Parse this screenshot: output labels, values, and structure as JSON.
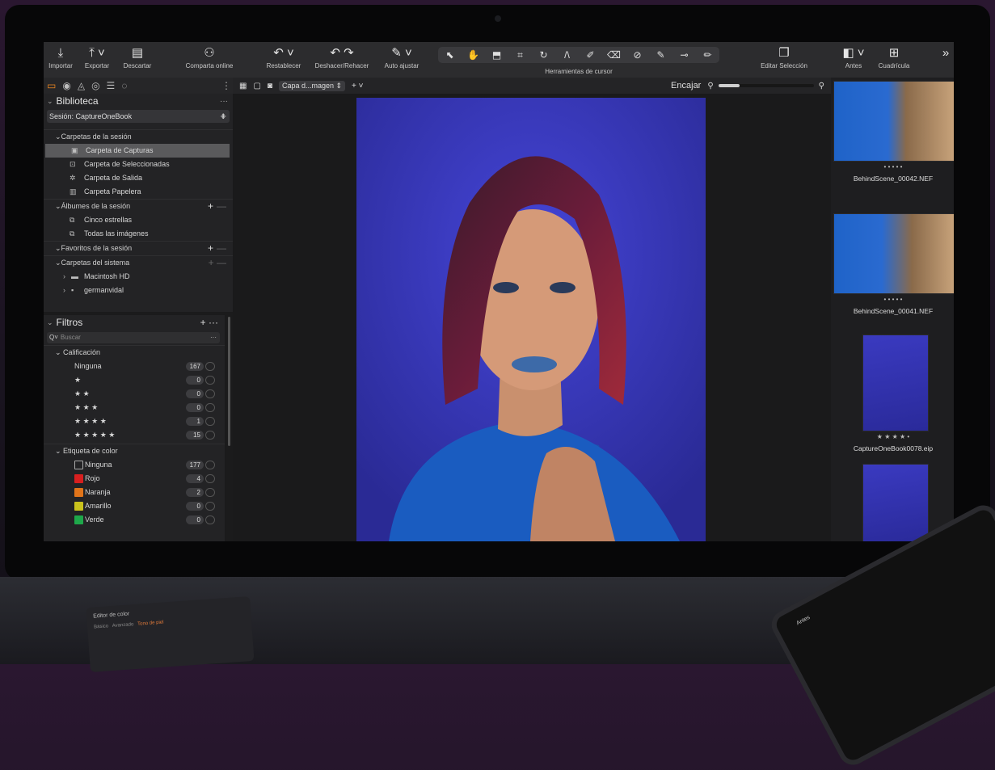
{
  "toolbar": {
    "left": [
      {
        "icon": "import-icon",
        "label": "Importar"
      },
      {
        "icon": "export-icon",
        "label": "Exportar"
      },
      {
        "icon": "discard-icon",
        "label": "Descartar"
      },
      {
        "icon": "share-online-icon",
        "label": "Comparta online"
      },
      {
        "icon": "reset-icon",
        "label": "Restablecer"
      },
      {
        "icon": "undo-redo-icon",
        "label": "Deshacer/Rehacer"
      },
      {
        "icon": "auto-adjust-icon",
        "label": "Auto ajustar"
      }
    ],
    "cursor_tools_label": "Herramientas de cursor",
    "right": [
      {
        "icon": "edit-selection-icon",
        "label": "Editar Selección"
      },
      {
        "icon": "before-icon",
        "label": "Antes"
      },
      {
        "icon": "grid-icon",
        "label": "Cuadrícula"
      }
    ],
    "overflow": "»"
  },
  "library": {
    "title": "Biblioteca",
    "session": "Sesión: CaptureOneBook",
    "groups": {
      "session_folders": "Carpetas de la sesión",
      "session_albums": "Álbumes de la sesión",
      "session_favorites": "Favoritos de la sesión",
      "system_folders": "Carpetas del sistema"
    },
    "folders": [
      "Carpeta de Capturas",
      "Carpeta de Seleccionadas",
      "Carpeta de Salida",
      "Carpeta Papelera"
    ],
    "albums": [
      "Cinco estrellas",
      "Todas las imágenes"
    ],
    "system": [
      "Macintosh HD",
      "germanvidal"
    ]
  },
  "filters": {
    "title": "Filtros",
    "search_placeholder": "Buscar",
    "rating_title": "Calificación",
    "ratings": [
      {
        "label": "Ninguna",
        "count": "167"
      },
      {
        "label": "★",
        "count": "0"
      },
      {
        "label": "★ ★",
        "count": "0"
      },
      {
        "label": "★ ★ ★",
        "count": "0"
      },
      {
        "label": "★ ★ ★ ★",
        "count": "1"
      },
      {
        "label": "★ ★ ★ ★ ★",
        "count": "15"
      }
    ],
    "color_title": "Etiqueta de color",
    "colors": [
      {
        "label": "Ninguna",
        "count": "177",
        "color": "none"
      },
      {
        "label": "Rojo",
        "count": "4",
        "color": "#d81f1f"
      },
      {
        "label": "Naranja",
        "count": "2",
        "color": "#e0741a"
      },
      {
        "label": "Amarillo",
        "count": "0",
        "color": "#c9c21d"
      },
      {
        "label": "Verde",
        "count": "0",
        "color": "#1ea84a"
      }
    ]
  },
  "viewer": {
    "layer_select": "Capa d...magen",
    "fit_label": "Encajar"
  },
  "browser": {
    "items": [
      {
        "name": "BehindScene_00042.NEF",
        "rating": "• • • • •"
      },
      {
        "name": "BehindScene_00041.NEF",
        "rating": "• • • • •"
      },
      {
        "name": "CaptureOneBook0078.eip",
        "rating": "★ ★ ★ ★ •"
      }
    ]
  },
  "desk_widget": {
    "title": "Editor de color",
    "tabs": [
      "Básico",
      "Avanzado",
      "Tono de piel"
    ]
  },
  "tablet": {
    "label": "Antes"
  },
  "colors": {
    "accent": "#f28a1f",
    "photo_bg": "#3434b8"
  }
}
